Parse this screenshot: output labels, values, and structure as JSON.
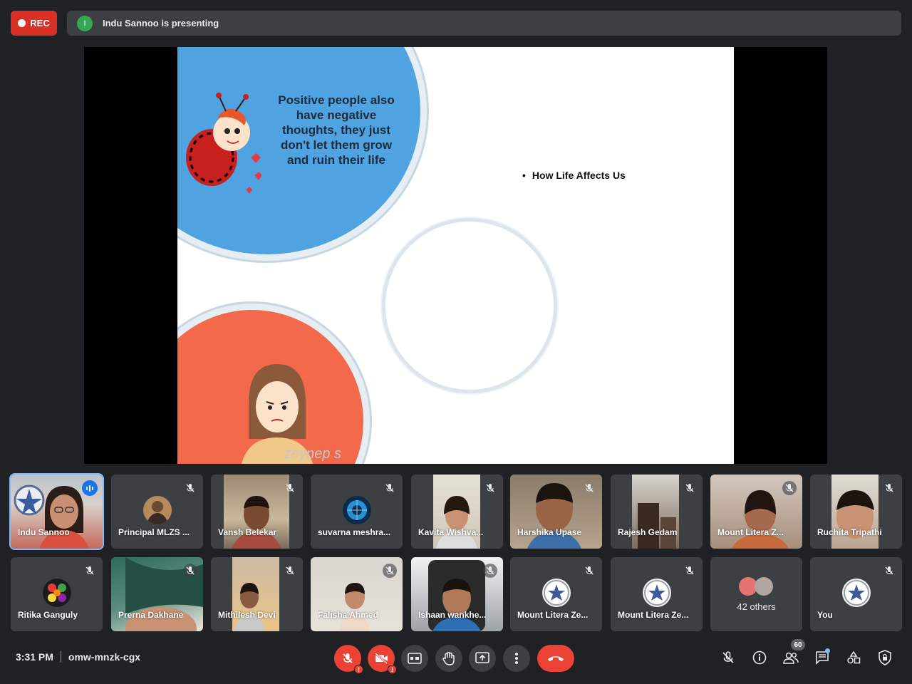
{
  "top_bar": {
    "rec_label": "REC",
    "presenter_initial": "I",
    "presenting_text": "Indu Sannoo is presenting"
  },
  "slide": {
    "quote": "Positive people also have negative thoughts, they just don't let them grow and ruin their life",
    "bullet": "How Life Affects Us",
    "watermark": "zeynep s"
  },
  "participants_row1": [
    {
      "name": "Indu Sannoo",
      "speaking": true
    },
    {
      "name": "Principal MLZS ...",
      "muted": true
    },
    {
      "name": "Vansh Belekar",
      "muted": true
    },
    {
      "name": "suvarna meshra...",
      "muted": true
    },
    {
      "name": "Kavita Wishva...",
      "muted": true
    },
    {
      "name": "Harshika Upase",
      "muted": true
    },
    {
      "name": "Rajesh Gedam",
      "muted": true
    },
    {
      "name": "Mount Litera Z...",
      "muted": true
    },
    {
      "name": "Ruchita Tripathi",
      "muted": true
    }
  ],
  "participants_row2": [
    {
      "name": "Ritika Ganguly",
      "muted": true
    },
    {
      "name": "Prerna Dakhane",
      "muted": true
    },
    {
      "name": "Mithilesh Devi",
      "muted": true
    },
    {
      "name": "Falisha Ahmed",
      "muted": true
    },
    {
      "name": "Ishaan wankhe...",
      "muted": true
    },
    {
      "name": "Mount Litera Ze...",
      "muted": true
    },
    {
      "name": "Mount Litera Ze...",
      "muted": true
    },
    {
      "name": "42 others"
    },
    {
      "name": "You",
      "muted": true
    }
  ],
  "bottom_bar": {
    "time": "3:31 PM",
    "meeting_code": "omw-mnzk-cgx",
    "participant_count": "60",
    "alert_mark": "!"
  },
  "colors": {
    "background": "#202124",
    "rec_red": "#d93025",
    "accent_blue": "#8ab4f8",
    "hangup_red": "#ea4335"
  }
}
